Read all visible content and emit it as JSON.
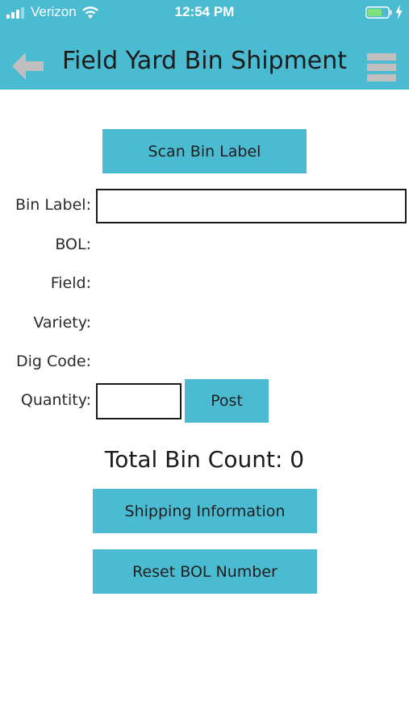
{
  "status_bar": {
    "carrier": "Verizon",
    "time": "12:54 PM",
    "battery_color": "#7ee07e"
  },
  "header": {
    "title": "Field Yard Bin Shipment",
    "back_icon": "back-arrow-icon",
    "menu_icon": "hamburger-menu-icon"
  },
  "form": {
    "scan_button_label": "Scan Bin Label",
    "bin_label": {
      "label": "Bin Label:",
      "value": ""
    },
    "bol": {
      "label": "BOL:",
      "value": ""
    },
    "field": {
      "label": "Field:",
      "value": ""
    },
    "variety": {
      "label": "Variety:",
      "value": ""
    },
    "dig_code": {
      "label": "Dig Code:",
      "value": ""
    },
    "quantity": {
      "label": "Quantity:",
      "value": ""
    },
    "post_button_label": "Post"
  },
  "summary": {
    "total_bin_count": "Total Bin Count: 0"
  },
  "actions": {
    "shipping_information_label": "Shipping Information",
    "reset_bol_label": "Reset BOL Number"
  },
  "colors": {
    "accent": "#4bbbd2",
    "header_icons": "#bfbfbf"
  }
}
